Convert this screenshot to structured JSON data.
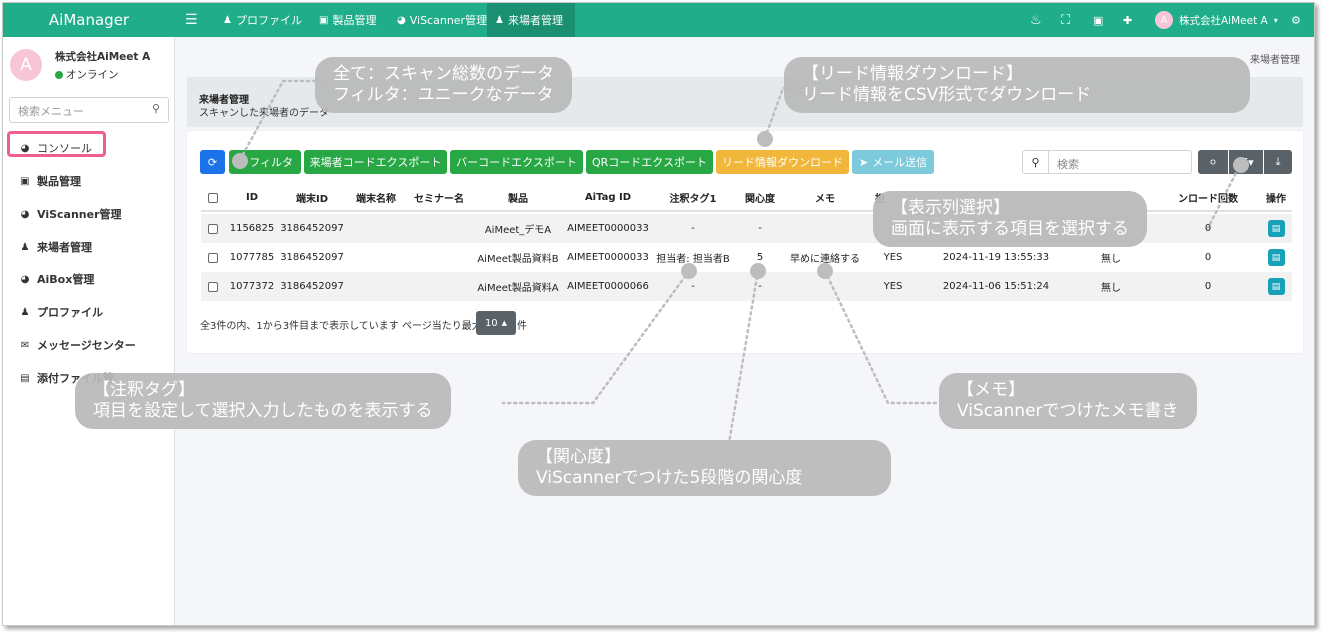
{
  "app": {
    "brand": "AiManager"
  },
  "topnav": {
    "items": [
      {
        "label": "プロファイル",
        "icon": "user-icon"
      },
      {
        "label": "製品管理",
        "icon": "product-icon"
      },
      {
        "label": "ViScanner管理",
        "icon": "gauge-icon"
      },
      {
        "label": "来場者管理",
        "icon": "users-icon"
      }
    ],
    "account": "株式会社AiMeet A",
    "avatar_letter": "A"
  },
  "sidebar": {
    "company": "株式会社AiMeet A",
    "status": "オンライン",
    "search_placeholder": "検索メニュー",
    "items": [
      {
        "label": "コンソール"
      },
      {
        "label": "製品管理"
      },
      {
        "label": "ViScanner管理"
      },
      {
        "label": "来場者管理"
      },
      {
        "label": "AiBox管理"
      },
      {
        "label": "プロファイル"
      },
      {
        "label": "メッセージセンター"
      },
      {
        "label": "添付ファイル管"
      }
    ]
  },
  "breadcrumb": "来場者管理",
  "header": {
    "title": "来場者管理",
    "subtitle": "スキャンした来場者のデータ"
  },
  "toolbar": {
    "filter": "フィルタ",
    "export_code": "来場者コードエクスポート",
    "export_barcode": "バーコードエクスポート",
    "export_qr": "QRコードエクスポート",
    "download_lead": "リード情報ダウンロード",
    "send_mail": "メール送信",
    "search_placeholder": "検索"
  },
  "table": {
    "columns": [
      "ID",
      "端末ID",
      "端末名称",
      "セミナー名",
      "製品",
      "AiTag ID",
      "注釈タグ1",
      "関心度",
      "メモ",
      "操作"
    ],
    "rows": [
      {
        "id": "1156825",
        "terminal_id": "3186452097",
        "terminal_name": "",
        "seminar": "",
        "product": "AiMeet_デモA",
        "aitag": "AIMEET0000033",
        "tag1": "-",
        "interest": "-",
        "memo": "",
        "yes": "",
        "date": "",
        "none": "",
        "count": "0"
      },
      {
        "id": "1077785",
        "terminal_id": "3186452097",
        "terminal_name": "",
        "seminar": "",
        "product": "AiMeet製品資料B",
        "aitag": "AIMEET0000033",
        "tag1": "担当者: 担当者B",
        "interest": "5",
        "memo": "早めに連絡する",
        "yes": "YES",
        "date": "2024-11-19 13:55:33",
        "none": "無し",
        "count": "0"
      },
      {
        "id": "1077372",
        "terminal_id": "3186452097",
        "terminal_name": "",
        "seminar": "",
        "product": "AiMeet製品資料A",
        "aitag": "AIMEET0000066",
        "tag1": "-",
        "interest": "-",
        "memo": "",
        "yes": "YES",
        "date": "2024-11-06 15:51:24",
        "none": "無し",
        "count": "0"
      }
    ],
    "partial_headers": {
      "col10": "担",
      "col13": "ンロード回数"
    }
  },
  "footer": {
    "summary": "全3件の内、1から3件目まで表示しています ページ当たり最大",
    "page_size": "10",
    "unit": "件"
  },
  "callouts": {
    "all_filter_line1": "全て：スキャン総数のデータ",
    "all_filter_line2": "フィルタ：ユニークなデータ",
    "lead_line1": "【リード情報ダウンロード】",
    "lead_line2": "リード情報をCSV形式でダウンロード",
    "columns_line1": "【表示列選択】",
    "columns_line2": "画面に表示する項目を選択する",
    "tag_line1": "【注釈タグ】",
    "tag_line2": "項目を設定して選択入力したものを表示する",
    "interest_line1": "【関心度】",
    "interest_line2": "ViScannerでつけた5段階の関心度",
    "memo_line1": "【メモ】",
    "memo_line2": "ViScannerでつけたメモ書き"
  },
  "colors": {
    "nav": "#20ad8a",
    "highlight": "#ef5d92",
    "callout": "#b9b9b9"
  }
}
